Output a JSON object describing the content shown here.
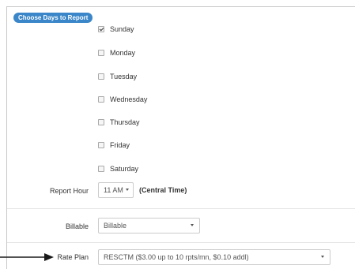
{
  "section": {
    "badge": "Choose Days to Report"
  },
  "days": [
    {
      "label": "Sunday",
      "checked": true
    },
    {
      "label": "Monday",
      "checked": false
    },
    {
      "label": "Tuesday",
      "checked": false
    },
    {
      "label": "Wednesday",
      "checked": false
    },
    {
      "label": "Thursday",
      "checked": false
    },
    {
      "label": "Friday",
      "checked": false
    },
    {
      "label": "Saturday",
      "checked": false
    }
  ],
  "report_hour": {
    "label": "Report Hour",
    "value": "11 AM",
    "timezone": "(Central Time)"
  },
  "billable": {
    "label": "Billable",
    "value": "Billable"
  },
  "rate_plan": {
    "label": "Rate Plan",
    "value": "RESCTM ($3.00 up to 10 rpts/mn, $0.10 addl)"
  },
  "colors": {
    "badge": "#3a86c8",
    "arrow": "#1a1a1a"
  },
  "icons": {
    "checkbox": "checkbox-icon",
    "dropdown": "chevron-down-icon",
    "pointer": "arrow-right-icon"
  }
}
